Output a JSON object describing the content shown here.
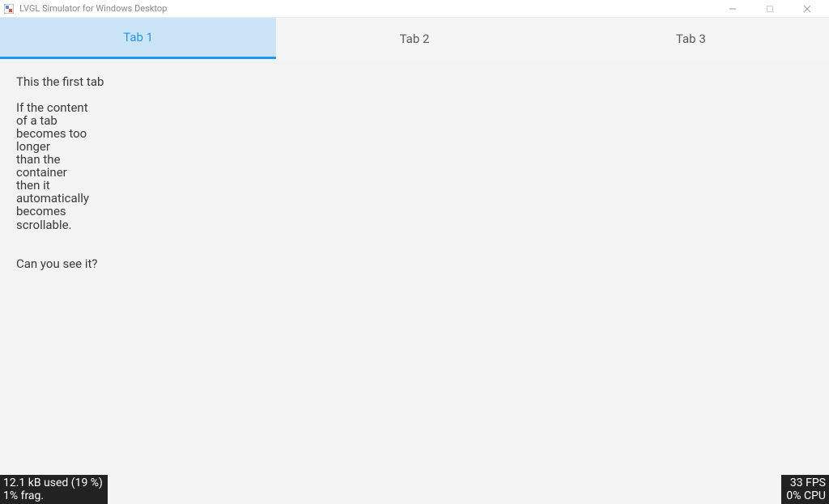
{
  "window": {
    "title": "LVGL Simulator for Windows Desktop"
  },
  "tabs": [
    {
      "label": "Tab 1",
      "active": true
    },
    {
      "label": "Tab 2",
      "active": false
    },
    {
      "label": "Tab 3",
      "active": false
    }
  ],
  "content": {
    "text": "This the first tab\n\nIf the content\nof a tab\nbecomes too\nlonger\nthan the\ncontainer\nthen it\nautomatically\nbecomes\nscrollable.\n\n\nCan you see it?"
  },
  "status": {
    "left_line1": "12.1 kB used (19 %)",
    "left_line2": "1% frag.",
    "right_line1": "33 FPS",
    "right_line2": "0% CPU"
  }
}
